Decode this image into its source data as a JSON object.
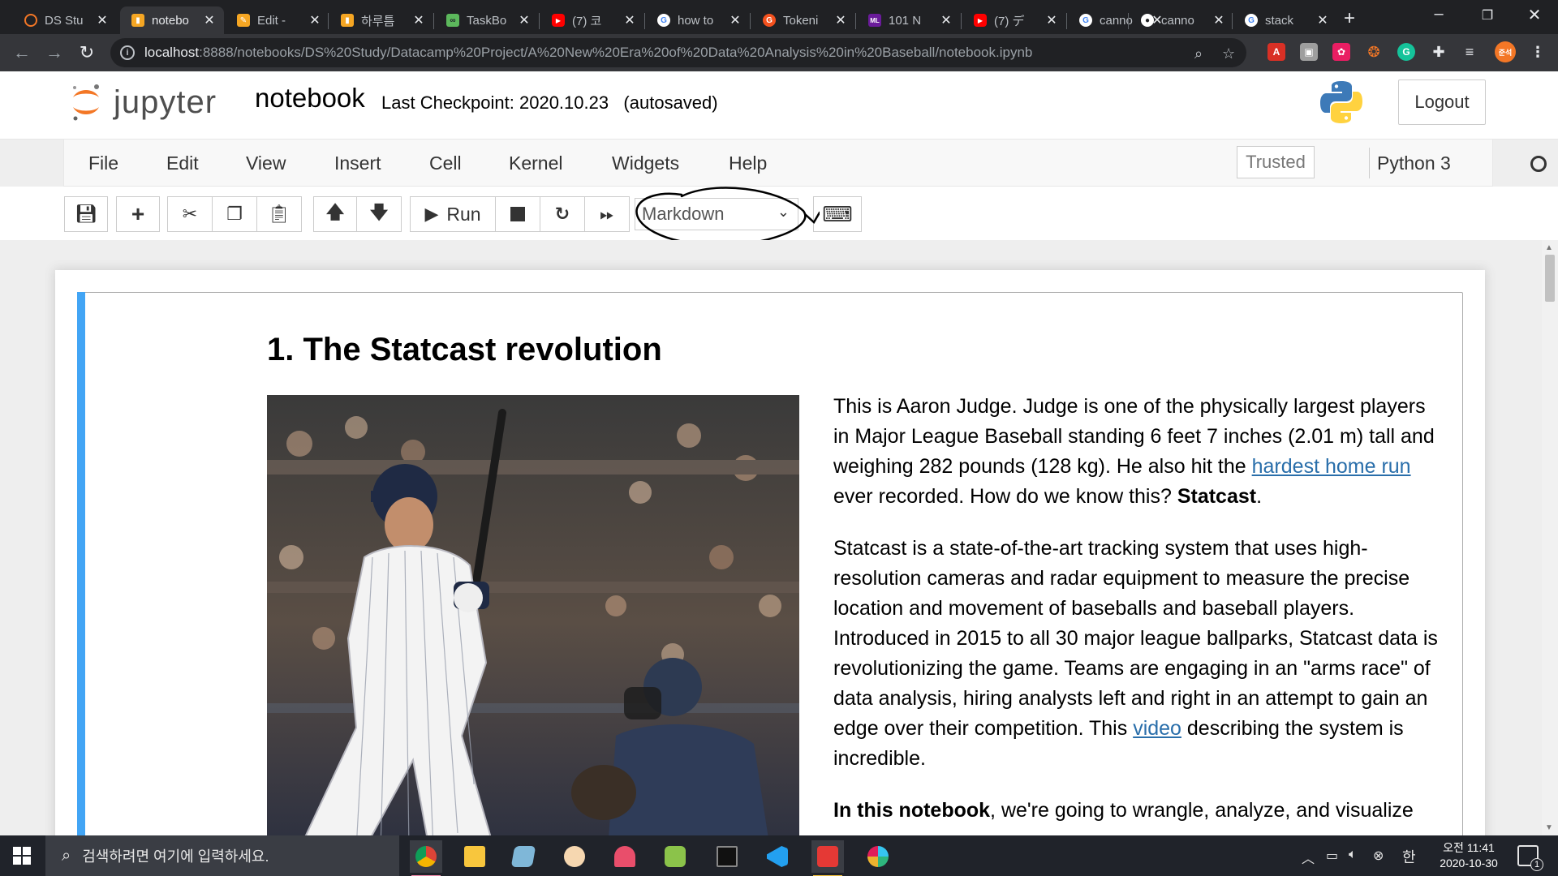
{
  "browser": {
    "tabs": [
      {
        "title": "DS Stu",
        "icon": "jupyter-icon",
        "color": "#f37726",
        "active": false
      },
      {
        "title": "notebo",
        "icon": "jupyter-book-icon",
        "color": "#f5a623",
        "active": true
      },
      {
        "title": "Edit -",
        "icon": "edit-icon",
        "color": "#f5a623",
        "active": false
      },
      {
        "title": "하루틈",
        "icon": "book-icon",
        "color": "#f5a623",
        "active": false
      },
      {
        "title": "TaskBo",
        "icon": "taskboard-icon",
        "color": "#5cb85c",
        "active": false
      },
      {
        "title": "(7) 코",
        "icon": "youtube-icon",
        "color": "#ff0000",
        "active": false
      },
      {
        "title": "how to",
        "icon": "google-icon",
        "color": "#4285f4",
        "active": false
      },
      {
        "title": "Tokeni",
        "icon": "tokenize-icon",
        "color": "#f4511e",
        "active": false
      },
      {
        "title": "101 N",
        "icon": "ml-icon",
        "color": "#6a1b9a",
        "active": false
      },
      {
        "title": "(7) デ",
        "icon": "youtube-icon",
        "color": "#ff0000",
        "active": false
      },
      {
        "title": "canno",
        "icon": "google-icon",
        "color": "#4285f4",
        "active": false
      },
      {
        "title": "canno",
        "icon": "github-icon",
        "color": "#ffffff",
        "active": false
      },
      {
        "title": "stack",
        "icon": "google-icon",
        "color": "#4285f4",
        "active": false
      }
    ],
    "url_host": "localhost",
    "url_path": ":8888/notebooks/DS%20Study/Datacamp%20Project/A%20New%20Era%20of%20Data%20Analysis%20in%20Baseball/notebook.ipynb",
    "profile_initial": "준석"
  },
  "jupyter": {
    "logo_text": "jupyter",
    "notebook_name": "notebook",
    "checkpoint": "Last Checkpoint: 2020.10.23   (autosaved)",
    "logout_label": "Logout",
    "menu": [
      "File",
      "Edit",
      "View",
      "Insert",
      "Cell",
      "Kernel",
      "Widgets",
      "Help"
    ],
    "trusted_label": "Trusted",
    "kernel_name": "Python 3",
    "run_label": "Run",
    "cell_type": "Markdown"
  },
  "cell": {
    "heading": "1. The Statcast revolution",
    "p1_start": "This is Aaron Judge. Judge is one of the physically largest players in Major League Baseball standing 6 feet 7 inches (2.01 m) tall and weighing 282 pounds (128 kg). He also hit the ",
    "p1_link": "hardest home run",
    "p1_mid": " ever recorded. How do we know this? ",
    "p1_bold": "Statcast",
    "p1_end": ".",
    "p2_start": "Statcast is a state-of-the-art tracking system that uses high-resolution cameras and radar equipment to measure the precise location and movement of baseballs and baseball players. Introduced in 2015 to all 30 major league ballparks, Statcast data is revolutionizing the game. Teams are engaging in an \"arms race\" of data analysis, hiring analysts left and right in an attempt to gain an edge over their competition. This ",
    "p2_link": "video",
    "p2_end": " describing the system is incredible.",
    "p3_bold": "In this notebook",
    "p3_rest": ", we're going to wrangle, analyze, and visualize"
  },
  "taskbar": {
    "search_placeholder": "검색하려면 여기에 입력하세요.",
    "time": "오전 11:41",
    "date": "2020-10-30",
    "ime": "한",
    "notification_count": "1"
  },
  "colors": {
    "jupyter_orange": "#f37726",
    "cell_selected_bar": "#42a5f5",
    "link": "#296eaa"
  }
}
